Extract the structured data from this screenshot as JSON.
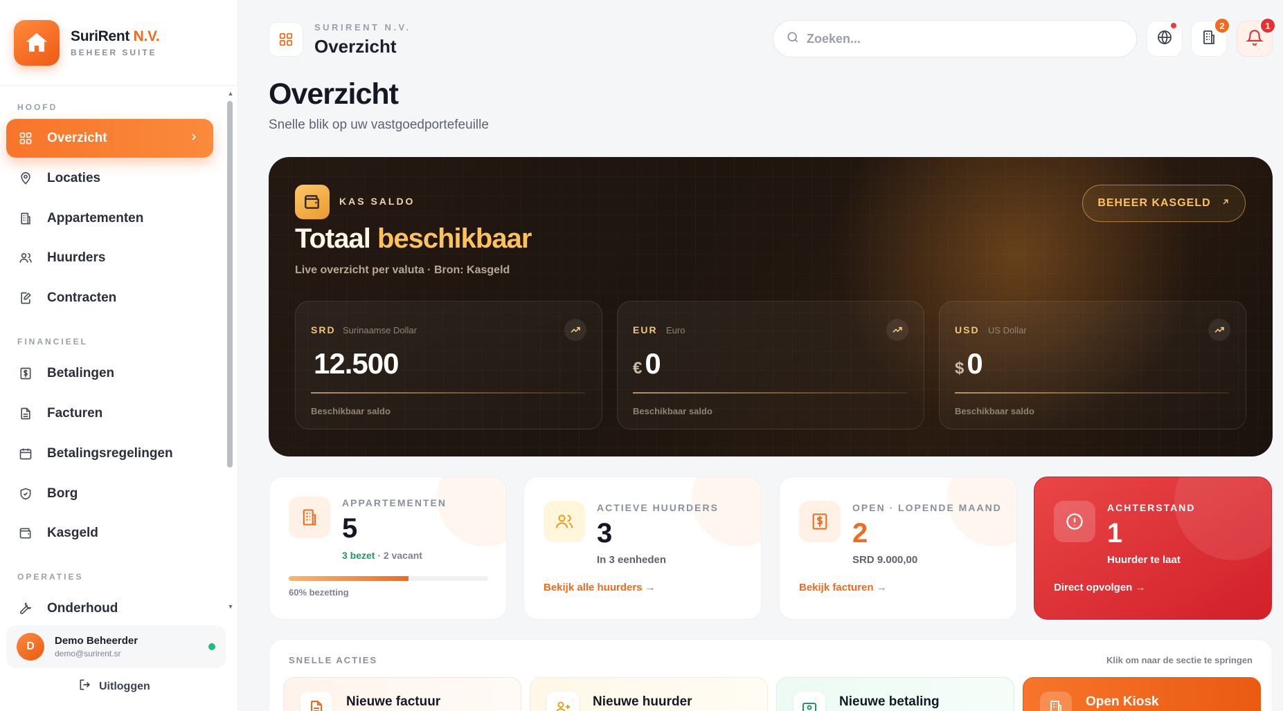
{
  "brand": {
    "name_main": "SuriRent",
    "name_accent": "N.V.",
    "subtitle": "BEHEER SUITE"
  },
  "sidebar": {
    "sections": [
      {
        "label": "HOOFD"
      },
      {
        "label": "FINANCIEEL"
      },
      {
        "label": "OPERATIES"
      }
    ],
    "items": [
      {
        "label": "Overzicht",
        "icon": "grid-icon",
        "active": true
      },
      {
        "label": "Locaties",
        "icon": "map-pin-icon"
      },
      {
        "label": "Appartementen",
        "icon": "building-icon"
      },
      {
        "label": "Huurders",
        "icon": "users-icon"
      },
      {
        "label": "Contracten",
        "icon": "file-edit-icon"
      },
      {
        "label": "Betalingen",
        "icon": "dollar-receipt-icon"
      },
      {
        "label": "Facturen",
        "icon": "file-text-icon"
      },
      {
        "label": "Betalingsregelingen",
        "icon": "calendar-icon"
      },
      {
        "label": "Borg",
        "icon": "shield-icon"
      },
      {
        "label": "Kasgeld",
        "icon": "wallet-icon"
      },
      {
        "label": "Onderhoud",
        "icon": "wrench-icon"
      }
    ],
    "user": {
      "initial": "D",
      "name": "Demo Beheerder",
      "email": "demo@surirent.sr"
    },
    "logout_label": "Uitloggen"
  },
  "header": {
    "breadcrumb": "SURIRENT N.V.",
    "title": "Overzicht",
    "search_placeholder": "Zoeken...",
    "badges": {
      "apartments": "2",
      "notifications": "1"
    }
  },
  "page": {
    "title": "Overzicht",
    "subtitle": "Snelle blik op uw vastgoedportefeuille"
  },
  "hero": {
    "label": "KAS SALDO",
    "title_part1": "Totaal",
    "title_part2": "beschikbaar",
    "subtitle": "Live overzicht per valuta · Bron: Kasgeld",
    "button": "BEHEER KASGELD",
    "currencies": [
      {
        "code": "SRD",
        "name": "Surinaamse Dollar",
        "symbol": "",
        "value": "12.500",
        "footer": "Beschikbaar saldo"
      },
      {
        "code": "EUR",
        "name": "Euro",
        "symbol": "€",
        "value": "0",
        "footer": "Beschikbaar saldo"
      },
      {
        "code": "USD",
        "name": "US Dollar",
        "symbol": "$",
        "value": "0",
        "footer": "Beschikbaar saldo"
      }
    ]
  },
  "stats": [
    {
      "label": "APPARTEMENTEN",
      "value": "5",
      "occupied": "3 bezet",
      "vacant": "· 2 vacant",
      "occupancy": 0.6,
      "occupancy_label": "60% bezetting"
    },
    {
      "label": "ACTIEVE HUURDERS",
      "value": "3",
      "note": "In 3 eenheden",
      "link": "Bekijk alle huurders →"
    },
    {
      "label": "OPEN · LOPENDE MAAND",
      "value": "2",
      "note": "SRD 9.000,00",
      "link": "Bekijk facturen →"
    },
    {
      "label": "ACHTERSTAND",
      "value": "1",
      "note": "Huurder te laat",
      "link": "Direct opvolgen →"
    }
  ],
  "quick_actions": {
    "title": "SNELLE ACTIES",
    "hint": "Klik om naar de sectie te springen",
    "items": [
      {
        "label": "Nieuwe factuur"
      },
      {
        "label": "Nieuwe huurder"
      },
      {
        "label": "Nieuwe betaling"
      },
      {
        "label": "Open Kiosk"
      }
    ]
  },
  "colors": {
    "accent": "#f26a1b",
    "danger": "#d1202a",
    "gold": "#ffc15a",
    "success": "#1bbf7a"
  }
}
